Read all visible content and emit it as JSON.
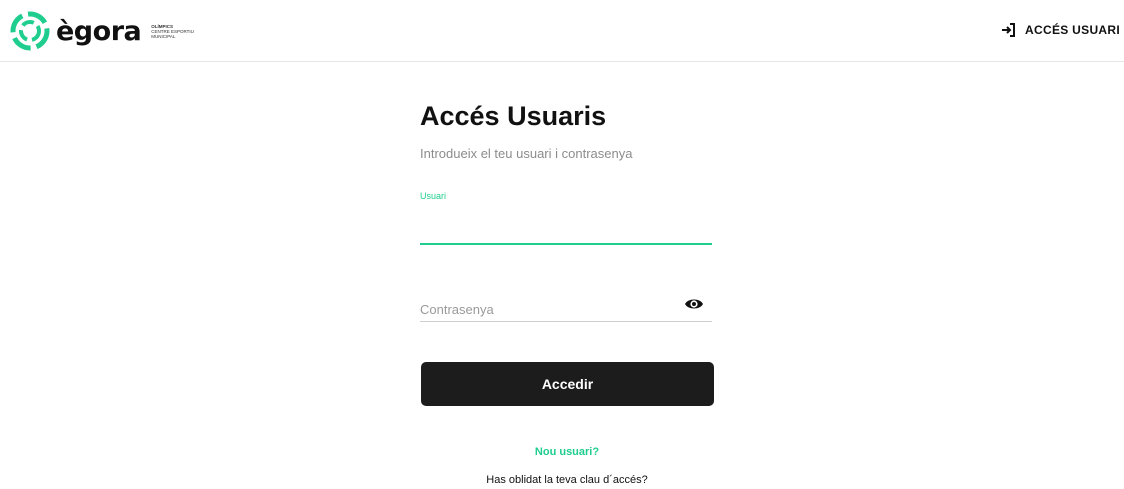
{
  "header": {
    "logo_word": "ègora",
    "logo_sub": [
      "OLÍMPICS",
      "CENTRE ESPORTIU",
      "MUNICIPAL"
    ],
    "access_label": "ACCÉS USUARI",
    "access_icon": "login-icon"
  },
  "login": {
    "title": "Accés Usuaris",
    "subtitle": "Introdueix el teu usuari i contrasenya",
    "user_label": "Usuari",
    "user_value": "",
    "password_placeholder": "Contrasenya",
    "password_value": "",
    "show_password_icon": "eye-icon",
    "submit_label": "Accedir",
    "new_user_link": "Nou usuari?",
    "forgot_link": "Has oblidat la teva clau d´accés?"
  },
  "colors": {
    "accent": "#1fce8e",
    "button": "#1c1c1c",
    "text": "#111111",
    "muted": "#8c8c8c"
  }
}
